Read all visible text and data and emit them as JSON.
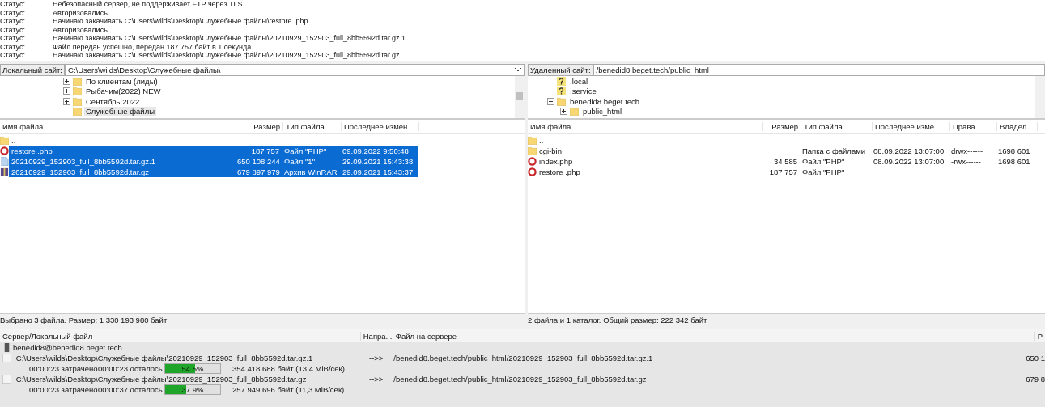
{
  "log": [
    {
      "label": "Статус:",
      "message": "Небезопасный сервер, не поддерживает FTP через TLS."
    },
    {
      "label": "Статус:",
      "message": "Авторизовались"
    },
    {
      "label": "Статус:",
      "message": "Начинаю закачивать C:\\Users\\wilds\\Desktop\\Служебные файлы\\restore .php"
    },
    {
      "label": "Статус:",
      "message": "Авторизовались"
    },
    {
      "label": "Статус:",
      "message": "Начинаю закачивать C:\\Users\\wilds\\Desktop\\Служебные файлы\\20210929_152903_full_8bb5592d.tar.gz.1"
    },
    {
      "label": "Статус:",
      "message": "Файл передан успешно, передан 187 757 байт в 1 секунда"
    },
    {
      "label": "Статус:",
      "message": "Начинаю закачивать C:\\Users\\wilds\\Desktop\\Служебные файлы\\20210929_152903_full_8bb5592d.tar.gz"
    }
  ],
  "local": {
    "site_label": "Локальный сайт:",
    "path": "C:\\Users\\wilds\\Desktop\\Служебные файлы\\",
    "tree": [
      {
        "name": "По клиентам (лиды)",
        "expandable": true,
        "selected": false
      },
      {
        "name": "Рыбачим(2022) NEW",
        "expandable": true,
        "selected": false
      },
      {
        "name": "Сентябрь 2022",
        "expandable": true,
        "selected": false
      },
      {
        "name": "Служебные файлы",
        "expandable": false,
        "selected": true
      }
    ],
    "columns": [
      "Имя файла",
      "Размер",
      "Тип файла",
      "Последнее измен..."
    ],
    "rows": [
      {
        "kind": "folder",
        "cells": [
          "..",
          "",
          "",
          ""
        ],
        "selected": false
      },
      {
        "kind": "php",
        "cells": [
          "restore .php",
          "187 757",
          "Файл \"PHP\"",
          "09.09.2022 9:50:48"
        ],
        "selected": true
      },
      {
        "kind": "file",
        "cells": [
          "20210929_152903_full_8bb5592d.tar.gz.1",
          "650 108 244",
          "Файл \"1\"",
          "29.09.2021 15:43:38"
        ],
        "selected": true
      },
      {
        "kind": "archive",
        "cells": [
          "20210929_152903_full_8bb5592d.tar.gz",
          "679 897 979",
          "Архив WinRAR",
          "29.09.2021 15:43:37"
        ],
        "selected": true
      }
    ],
    "status": "Выбрано 3 файла. Размер: 1 330 193 980 байт"
  },
  "remote": {
    "site_label": "Удаленный сайт:",
    "path": "/benedid8.beget.tech/public_html",
    "tree": [
      {
        "name": ".local",
        "kind": "unknown"
      },
      {
        "name": ".service",
        "kind": "unknown"
      },
      {
        "name": "benedid8.beget.tech",
        "kind": "folder",
        "expanded": true,
        "children": [
          {
            "name": "public_html",
            "kind": "folder",
            "expanded": false
          }
        ]
      }
    ],
    "columns": [
      "Имя файла",
      "Размер",
      "Тип файла",
      "Последнее изме...",
      "Права",
      "Владел..."
    ],
    "rows": [
      {
        "kind": "folder",
        "cells": [
          "..",
          "",
          "",
          "",
          "",
          ""
        ],
        "selected": false
      },
      {
        "kind": "folder",
        "cells": [
          "cgi-bin",
          "",
          "Папка с файлами",
          "08.09.2022 13:07:00",
          "drwx------",
          "1698 601"
        ],
        "selected": false
      },
      {
        "kind": "php",
        "cells": [
          "index.php",
          "34 585",
          "Файл \"PHP\"",
          "08.09.2022 13:07:00",
          "-rwx------",
          "1698 601"
        ],
        "selected": false
      },
      {
        "kind": "php",
        "cells": [
          "restore .php",
          "187 757",
          "Файл \"PHP\"",
          "",
          "",
          ""
        ],
        "selected": false
      }
    ],
    "status": "2 файла и 1 каталог. Общий размер: 222 342 байт"
  },
  "queue": {
    "columns": [
      "Сервер/Локальный файл",
      "Напра...",
      "Файл на сервере",
      "Р"
    ],
    "server": "benedid8@benedid8.beget.tech",
    "items": [
      {
        "local": "C:\\Users\\wilds\\Desktop\\Служебные файлы\\20210929_152903_full_8bb5592d.tar.gz.1",
        "direction": "-->>",
        "remote": "/benedid8.beget.tech/public_html/20210929_152903_full_8bb5592d.tar.gz.1",
        "size": "650 1",
        "elapsed": "00:00:23 затрачено",
        "remaining": "00:00:23 осталось",
        "level": 0.545,
        "percent": "54.5%",
        "transferred": "354 418 688 байт (13,4 MiB/сек)"
      },
      {
        "local": "C:\\Users\\wilds\\Desktop\\Служебные файлы\\20210929_152903_full_8bb5592d.tar.gz",
        "direction": "-->>",
        "remote": "/benedid8.beget.tech/public_html/20210929_152903_full_8bb5592d.tar.gz",
        "size": "679 8",
        "elapsed": "00:00:23 затрачено",
        "remaining": "00:00:37 осталось",
        "level": 0.379,
        "percent": "37.9%",
        "transferred": "257 949 696 байт (11,3 MiB/сек)"
      }
    ]
  }
}
